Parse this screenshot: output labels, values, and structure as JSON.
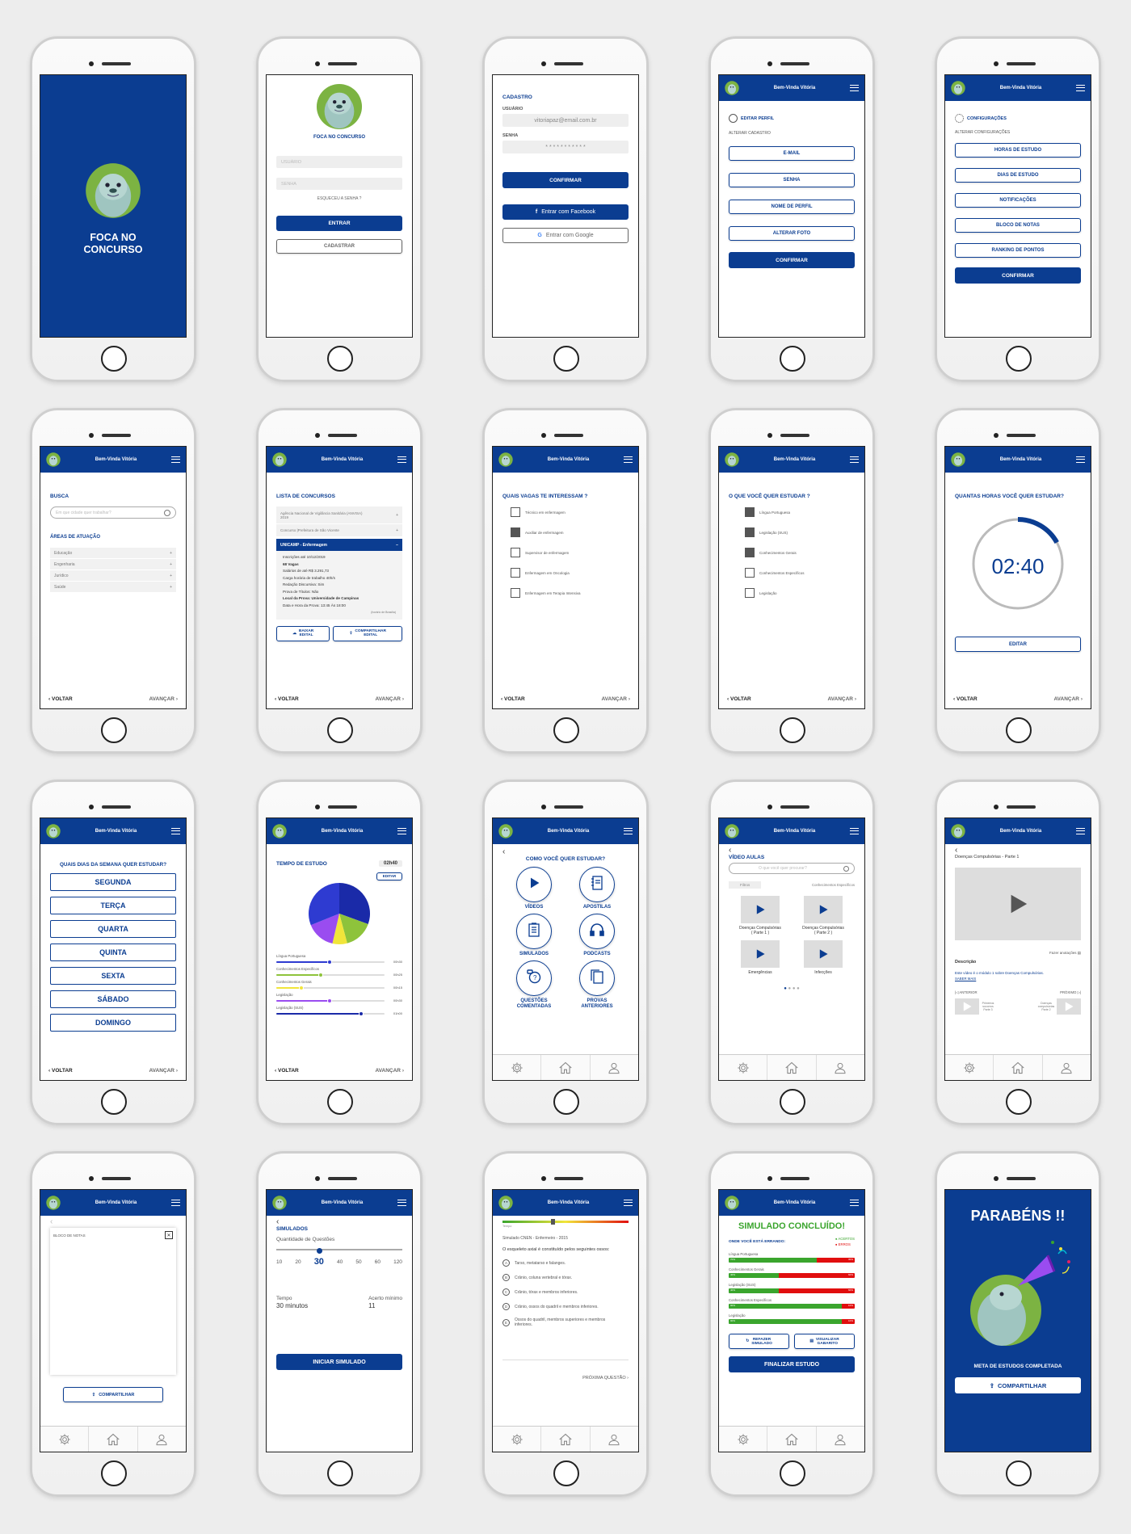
{
  "common": {
    "header": "Bem-Vinda Vitória",
    "voltar": "VOLTAR",
    "avancar": "AVANÇAR",
    "brand": "FOCA NO\nCONCURSO",
    "brand_small": "FOCA NO CONCURSO",
    "confirmar": "CONFIRMAR",
    "compartilhar": "COMPARTILHAR"
  },
  "login": {
    "usuario": "USUÁRIO",
    "senha": "SENHA",
    "esqueceu": "ESQUECEU A SENHA ?",
    "entrar": "ENTRAR",
    "cadastrar": "CADASTRAR"
  },
  "cadastro": {
    "title": "CADASTRO",
    "usuario_label": "USUÁRIO",
    "usuario_value": "vitoriapaz@email.com.br",
    "senha_label": "SENHA",
    "senha_value": "* * * * * * * * * * *",
    "facebook": "Entrar com Facebook",
    "google": "Entrar com Google"
  },
  "editar": {
    "title": "EDITAR PERFIL",
    "sub": "ALTERAR CADASTRO",
    "items": [
      "E-MAIL",
      "SENHA",
      "NOME DE PERFIL",
      "ALTERAR FOTO"
    ]
  },
  "config": {
    "title": "CONFIGURAÇÕES",
    "sub": "ALTERAR CONFIGURAÇÕES",
    "items": [
      "HORAS DE ESTUDO",
      "DIAS DE ESTUDO",
      "NOTIFICAÇÕES",
      "BLOCO DE NOTAS",
      "RANKING DE PONTOS"
    ]
  },
  "busca": {
    "title": "BUSCA",
    "placeholder": "Em que cidade quer trabalhar?",
    "areas": "ÁREAS DE ATUAÇÃO",
    "items": [
      "Educação",
      "Engenharia",
      "Jurídico",
      "Saúde"
    ]
  },
  "lista": {
    "title": "LISTA DE CONCURSOS",
    "items": [
      "Agência Nacional de Vigilância Sanitária (ANVISA) 2019",
      "Concurso |Prefeitura de São Vicente"
    ],
    "open": "UNICAMP - Enfermagem",
    "details": [
      "Inscrições até 10/12/2019",
      "68 Vagas",
      "Salários de até R$ 3.291,73",
      "Carga horária de trabalho 40h/s",
      "Redação Discursiva: Sim",
      "Prova de Títulos: Não",
      "Local da Prova: Universidade de Campinas",
      "Data e Hora da Prova: 13:45 Às 18:00"
    ],
    "tz": "(horário de Brasília)",
    "baixar": "BAIXAR\nEDITAL",
    "compartilhar": "COMPARTILHAR\nEDITAL"
  },
  "vagas": {
    "title": "QUAIS VAGAS TE INTERESSAM ?",
    "items": [
      "Técnico em enfermagem",
      "Auxiliar de enfermagem",
      "Supervisor de enfermagem",
      "Enfermagem em Oncologia",
      "Enfermagem em Terapia Intensiva"
    ],
    "checked": [
      false,
      true,
      false,
      false,
      false
    ]
  },
  "estudar": {
    "title": "O QUE VOCÊ QUER ESTUDAR ?",
    "items": [
      "Língua Portuguesa",
      "Legislação (SUS)",
      "Conhecimentos Gerais",
      "Conhecimentos Específicos",
      "Legislação"
    ],
    "checked": [
      true,
      true,
      true,
      false,
      false
    ]
  },
  "horas": {
    "title": "QUANTAS HORAS VOCÊ QUER ESTUDAR?",
    "time": "02:40",
    "editar": "EDITAR",
    "progress": 0.17
  },
  "dias": {
    "title": "QUAIS DIAS DA SEMANA QUER ESTUDAR?",
    "items": [
      "SEGUNDA",
      "TERÇA",
      "QUARTA",
      "QUINTA",
      "SEXTA",
      "SÁBADO",
      "DOMINGO"
    ]
  },
  "tempo": {
    "title": "TEMPO DE ESTUDO",
    "total": "02h40",
    "editar": "EDITAR",
    "subjects": [
      {
        "name": "Língua Portuguesa",
        "value": "00h30",
        "level": 0.6,
        "color": "#2e3bd1"
      },
      {
        "name": "Conhecimentos Específicos",
        "value": "00h25",
        "level": 0.5,
        "color": "#8ec33b"
      },
      {
        "name": "Conhecimentos Gerais",
        "value": "00h15",
        "level": 0.28,
        "color": "#f1e53a"
      },
      {
        "name": "Legislação",
        "value": "00h30",
        "level": 0.6,
        "color": "#9a4cf0"
      },
      {
        "name": "Legislação (SUS)",
        "value": "01h00",
        "level": 0.95,
        "color": "#1a2aa8"
      }
    ],
    "pie": [
      {
        "value": 110,
        "color": "#1a2aa8"
      },
      {
        "value": 55,
        "color": "#8ec33b"
      },
      {
        "value": 28,
        "color": "#f1e53a"
      },
      {
        "value": 55,
        "color": "#9a4cf0"
      },
      {
        "value": 112,
        "color": "#2e3bd1"
      }
    ]
  },
  "como": {
    "title": "COMO VOCÊ QUER ESTUDAR?",
    "items": [
      "VÍDEOS",
      "APOSTILAS",
      "SIMULADOS",
      "PODCASTS",
      "QUESTÕES COMENTADAS",
      "PROVAS ANTERIORES"
    ]
  },
  "videos": {
    "title": "VÍDEO AULAS",
    "placeholder": "O que você quer procurar?",
    "filtro": "Filtros",
    "filtro_val": "Conhecimentos Específicos",
    "items": [
      "Doenças Compulsórias\n( Parte 1 )",
      "Doenças Compulsórias\n( Parte 2 )",
      "Emergências",
      "Infecções"
    ]
  },
  "player": {
    "title": "Doenças Compulsórias - Parte 1",
    "anotacoes": "Fazer anotações",
    "desc_label": "Descrição",
    "desc": "Este vídeo é o módulo 1 sobre Doenças Compulsórias.",
    "saiba": "SABER MAIS",
    "anterior": "ANTERIOR",
    "proximo": "PRÓXIMO",
    "prev_title": "Primeiros socorros Parte 3",
    "next_title": "Doenças compulsórias Parte 2"
  },
  "bloco": {
    "title": "BLOCO DE NOTAS"
  },
  "simulados": {
    "title": "SIMULADOS",
    "qtd": "Quantidade de Questões",
    "options": [
      "10",
      "20",
      "30",
      "40",
      "50",
      "60",
      "120"
    ],
    "selected": "30",
    "tempo_label": "Tempo",
    "tempo": "30 minutos",
    "acerto_label": "Acerto mínimo",
    "acerto": "11",
    "iniciar": "INICIAR SIMULADO"
  },
  "questao": {
    "tempo": "Tempo",
    "title": "Simulado CNEN - Enfermeiro - 2015",
    "q": "O esqueleto axial é constituído pelos seguintes ossos:",
    "opts": [
      {
        "k": "A",
        "t": "Tarso, metatarso e falanges."
      },
      {
        "k": "B",
        "t": "Crânio, coluna vertebral e tórax."
      },
      {
        "k": "C",
        "t": "Crânio, tórax e membros inferiores."
      },
      {
        "k": "D",
        "t": "Crânio, ossos do quadril e membros inferiores."
      },
      {
        "k": "E",
        "t": "Ossos do quadril, membros superiores e membros inferiores."
      }
    ],
    "proxima": "PRÓXIMA QUESTÃO"
  },
  "concluido": {
    "title": "SIMULADO CONCLUÍDO!",
    "sub": "ONDE VOCÊ ESTÁ ERRANDO:",
    "acertos": "ACERTOS",
    "erros": "ERROS",
    "items": [
      {
        "name": "Língua Portuguesa",
        "ok": 0.7,
        "okl": "70%",
        "errl": "30%"
      },
      {
        "name": "Conhecimentos Gerais",
        "ok": 0.4,
        "okl": "40%",
        "errl": "60%"
      },
      {
        "name": "Legislação (SUS)",
        "ok": 0.4,
        "okl": "40%",
        "errl": "60%"
      },
      {
        "name": "Conhecimentos Específicos",
        "ok": 0.9,
        "okl": "90%",
        "errl": "10%"
      },
      {
        "name": "Legislação",
        "ok": 0.9,
        "okl": "90%",
        "errl": "10%"
      }
    ],
    "refazer": "REFAZER\nSIMULADO",
    "visualizar": "VISUALIZAR\nGABARITO",
    "finalizar": "FINALIZAR ESTUDO"
  },
  "parabens": {
    "title": "PARABÉNS !!",
    "meta": "META DE ESTUDOS COMPLETADA"
  }
}
